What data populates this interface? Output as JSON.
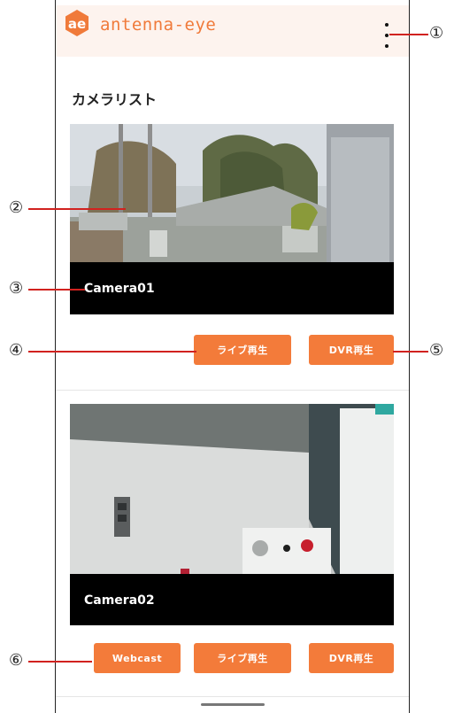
{
  "app": {
    "name": "antenna-eye",
    "logo_text": "ae",
    "brand_color": "#f07a3a"
  },
  "page": {
    "title": "カメラリスト"
  },
  "cameras": [
    {
      "name": "Camera01",
      "buttons": [
        {
          "label": "ライブ再生"
        },
        {
          "label": "DVR再生"
        }
      ]
    },
    {
      "name": "Camera02",
      "buttons": [
        {
          "label": "Webcast"
        },
        {
          "label": "ライブ再生"
        },
        {
          "label": "DVR再生"
        }
      ]
    }
  ],
  "callouts": [
    "①",
    "②",
    "③",
    "④",
    "⑤",
    "⑥"
  ],
  "icons": {
    "menu": "more-vertical-icon",
    "logo": "antenna-eye-logo-icon"
  },
  "colors": {
    "button": "#f37b3a",
    "callout_line": "#d1221f",
    "appbar_bg": "#fdf3ee"
  }
}
